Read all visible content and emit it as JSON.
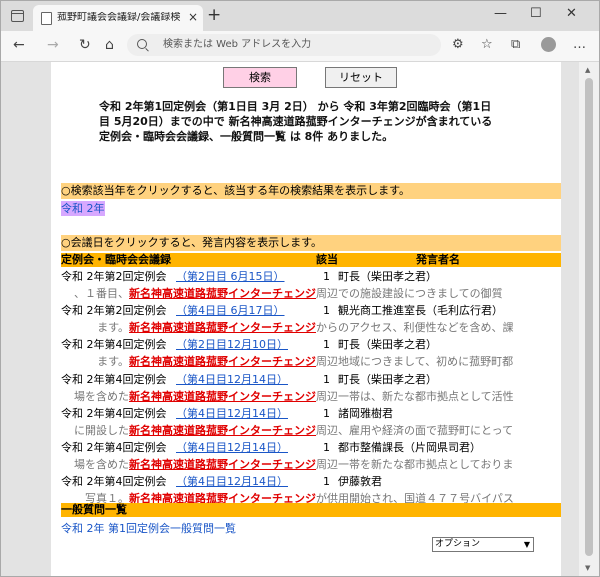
{
  "browser": {
    "tab_title": "菰野町議会会議録/会議録検索シス",
    "tab_close": "×",
    "new_tab": "+",
    "window_controls": [
      "—",
      "☐",
      "✕"
    ],
    "address_placeholder": "検索または Web アドレスを入力"
  },
  "page": {
    "buttons": {
      "search": "検索",
      "reset": "リセット"
    },
    "summary": "令和 2年第1回定例会（第1日目 3月 2日） から 令和 3年第2回臨時会（第1日目 5月20日）までの中で 新名神高速道路菰野インターチェンジが含まれている 定例会・臨時会会議録、一般質問一覧 は 8件 ありました。",
    "year_notice": "○検索該当年をクリックすると、該当する年の検索結果を表示します。",
    "year_link": "令和 2年",
    "date_notice": "○会議日をクリックすると、発言内容を表示します。",
    "table": {
      "headers": [
        "定例会・臨時会会議録",
        "該当",
        "発言者名"
      ],
      "keyword": "新名神高速道路菰野インターチェンジ",
      "rows": [
        {
          "session": "令和 2年第2回定例会",
          "date": "（第2日目 6月15日）",
          "count": "1",
          "speaker": "町長（柴田孝之君）",
          "pre": "、１番目、",
          "post": "周辺での施設建設につきましての御質"
        },
        {
          "session": "令和 2年第2回定例会",
          "date": "（第4日目 6月17日）",
          "count": "1",
          "speaker": "観光商工推進室長（毛利広行君）",
          "pre": "ます。",
          "post": "からのアクセス、利便性などを含め、課"
        },
        {
          "session": "令和 2年第4回定例会",
          "date": "（第2日目12月10日）",
          "count": "1",
          "speaker": "町長（柴田孝之君）",
          "pre": "ます。",
          "post": "周辺地域につきまして、初めに菰野町都"
        },
        {
          "session": "令和 2年第4回定例会",
          "date": "（第4日目12月14日）",
          "count": "1",
          "speaker": "町長（柴田孝之君）",
          "pre": "場を含めた",
          "post": "周辺一帯は、新たな都市拠点として活性"
        },
        {
          "session": "令和 2年第4回定例会",
          "date": "（第4日目12月14日）",
          "count": "1",
          "speaker": "諸岡雅樹君",
          "pre": "に開設した",
          "post": "周辺、雇用や経済の面で菰野町にとって"
        },
        {
          "session": "令和 2年第4回定例会",
          "date": "（第4日目12月14日）",
          "count": "1",
          "speaker": "都市整備課長（片岡県司君）",
          "pre": "場を含めた",
          "post": "周辺一帯を新たな都市拠点としておりま"
        },
        {
          "session": "令和 2年第4回定例会",
          "date": "（第4日目12月14日）",
          "count": "1",
          "speaker": "伊藤敦君",
          "pre": "写真１。",
          "post": "が供用開始され、国道４７７号バイパス"
        }
      ]
    },
    "general_section": "一般質問一覧",
    "general_link": "令和 2年 第1回定例会一般質問一覧",
    "option_select": "オプション"
  }
}
